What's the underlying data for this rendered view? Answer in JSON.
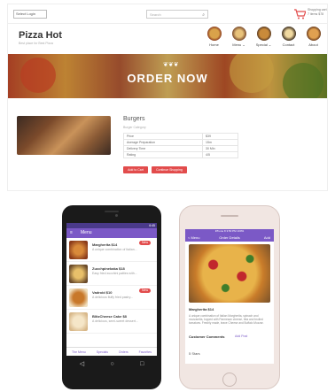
{
  "website": {
    "topbar": {
      "select_label": "Select Login",
      "search_placeholder": "Search",
      "cart_line1": "Shopping cart",
      "cart_line2": "7 items $78"
    },
    "logo": "Pizza Hot",
    "tagline": "Best place for Best Pizza",
    "nav": [
      {
        "label": "Home"
      },
      {
        "label": "Menu ⌄"
      },
      {
        "label": "Special ⌄"
      },
      {
        "label": "Contact"
      },
      {
        "label": "About"
      }
    ],
    "banner": {
      "ornament": "❦❦❦",
      "title": "ORDER NOW"
    },
    "product": {
      "name": "Burgers",
      "category": "Burger Category",
      "specs": [
        {
          "label": "Price",
          "value": "$39"
        },
        {
          "label": "Average Preparation",
          "value": "15m"
        },
        {
          "label": "Delivery Time",
          "value": "30 Min"
        },
        {
          "label": "Rating",
          "value": "4/5"
        }
      ],
      "add_button": "Add to Cart",
      "continue_button": "Continue Shopping"
    }
  },
  "android_app": {
    "status_time": "6:45",
    "title": "Menu",
    "items": [
      {
        "name": "Margherita $14",
        "desc": "A unique combination of Italian...",
        "badge": "New"
      },
      {
        "name": "Zucchpinekaka $18",
        "desc": "Easy fried zucchini patties with..."
      },
      {
        "name": "Vadroid $10",
        "desc": "A delicious fluffy fried pastry...",
        "badge": "New"
      },
      {
        "name": "BlitzCheese Cake $8",
        "desc": "A delicious, semi-sweet dessert..."
      }
    ],
    "tabs": [
      "The Menu",
      "Specials",
      "Orders",
      "Favorites"
    ]
  },
  "ios_app": {
    "status": "iPhone 8   3:50 PM   100%",
    "back": "< Menu",
    "title": "Order Details",
    "action": "Add",
    "item_name": "Margherita $14",
    "item_desc": "A unique combination of Italian Margherita, spinach and mozzarella, topped with Parmesan cheese, feta and broiled tomatoes. Freshly made, leave Cheese and Buffalo Mozzar.",
    "comments_title": "Customer Comments",
    "comments_link": "Add Post",
    "stars": "5 Stars"
  },
  "colors": {
    "accent_red": "#e24c4c",
    "app_purple": "#7b59c6"
  }
}
